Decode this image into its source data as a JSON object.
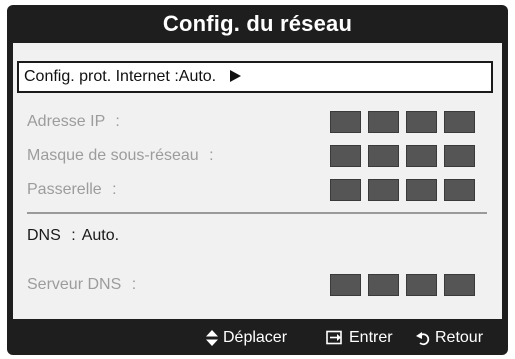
{
  "window": {
    "title": "Config. du réseau"
  },
  "settings": {
    "protocol": {
      "label": "Config. prot. Internet",
      "value": "Auto."
    },
    "ip_address": {
      "label": "Adresse IP"
    },
    "subnet_mask": {
      "label": "Masque de sous-réseau"
    },
    "gateway": {
      "label": "Passerelle"
    },
    "dns": {
      "label": "DNS",
      "value": "Auto."
    },
    "dns_server": {
      "label": "Serveur DNS"
    }
  },
  "footer": {
    "move_label": "Déplacer",
    "enter_label": "Entrer",
    "return_label": "Retour"
  },
  "colors": {
    "frame": "#1e1e1e",
    "panel": "#f1f1f1",
    "disabled_text": "#9c9c9c",
    "value_box": "#555555"
  }
}
